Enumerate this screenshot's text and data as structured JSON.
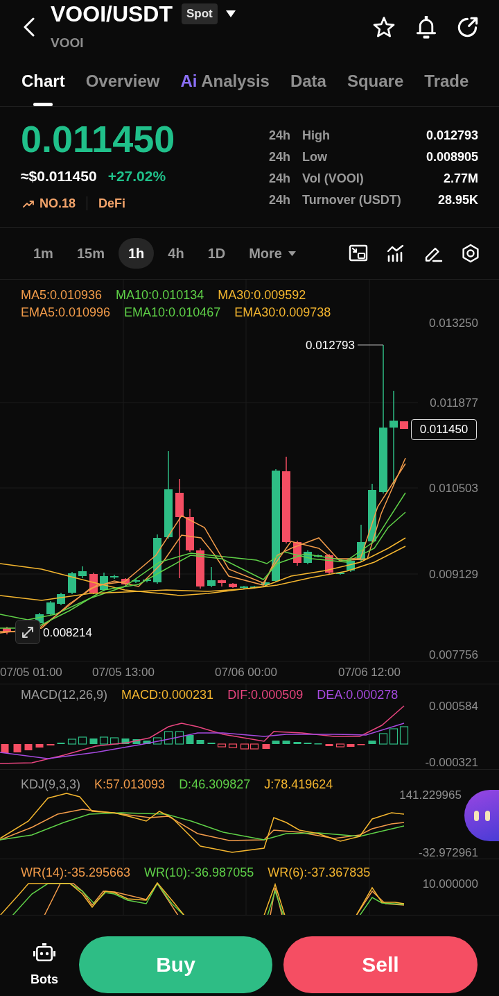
{
  "header": {
    "title": "VOOI/USDT",
    "market_type": "Spot",
    "subtitle": "VOOI"
  },
  "tabs": [
    {
      "label": "Chart",
      "selected": true
    },
    {
      "label": "Overview",
      "selected": false
    },
    {
      "label": "Analysis",
      "prefix": "Ai",
      "selected": false
    },
    {
      "label": "Data",
      "selected": false
    },
    {
      "label": "Square",
      "selected": false
    },
    {
      "label": "Trade",
      "selected": false
    }
  ],
  "ticker": {
    "price": "0.011450",
    "usd_price": "≈$0.011450",
    "change": "+27.02%",
    "rank": "NO.18",
    "sector": "DeFi",
    "stats": [
      {
        "period": "24h",
        "label": "High",
        "value": "0.012793"
      },
      {
        "period": "24h",
        "label": "Low",
        "value": "0.008905"
      },
      {
        "period": "24h",
        "label": "Vol (VOOI)",
        "value": "2.77M"
      },
      {
        "period": "24h",
        "label": "Turnover (USDT)",
        "value": "28.95K"
      }
    ]
  },
  "intervals": [
    {
      "label": "1m",
      "kind": "interval",
      "selected": false
    },
    {
      "label": "15m",
      "kind": "interval",
      "selected": false
    },
    {
      "label": "1h",
      "kind": "interval",
      "selected": true
    },
    {
      "label": "4h",
      "kind": "interval",
      "selected": false
    },
    {
      "label": "1D",
      "kind": "interval",
      "selected": false
    },
    {
      "label": "More",
      "kind": "menu",
      "selected": false
    }
  ],
  "price_chart": {
    "legend_rows": [
      [
        {
          "text": "MA5:0.010936",
          "color": "#f39c4a"
        },
        {
          "text": "MA10:0.010134",
          "color": "#5fd148"
        },
        {
          "text": "MA30:0.009592",
          "color": "#f4b62f"
        }
      ],
      [
        {
          "text": "EMA5:0.010996",
          "color": "#f39c4a"
        },
        {
          "text": "EMA10:0.010467",
          "color": "#5fd148"
        },
        {
          "text": "EMA30:0.009738",
          "color": "#f4b62f"
        }
      ]
    ],
    "y_axis": [
      "0.013250",
      "0.011877",
      "0.010503",
      "0.009129",
      "0.007756"
    ],
    "x_axis": [
      "07/05 01:00",
      "07/05 13:00",
      "07/06 00:00",
      "07/06 12:00"
    ],
    "high_label": "0.012793",
    "low_label": "0.008214",
    "last_price": "0.011450"
  },
  "macd": {
    "title": "MACD(12,26,9)",
    "legend": [
      {
        "text": "MACD:0.000231",
        "color": "#f4b62f"
      },
      {
        "text": "DIF:0.000509",
        "color": "#e8457f"
      },
      {
        "text": "DEA:0.000278",
        "color": "#a64ae0"
      }
    ],
    "y_axis": [
      "0.000584",
      "-0.000321"
    ]
  },
  "kdj": {
    "title": "KDJ(9,3,3)",
    "legend": [
      {
        "text": "K:57.013093",
        "color": "#f39c4a"
      },
      {
        "text": "D:46.309827",
        "color": "#5fd148"
      },
      {
        "text": "J:78.419624",
        "color": "#f4b62f"
      }
    ],
    "y_axis": [
      "141.229965",
      "-32.972961"
    ]
  },
  "wr": {
    "legend": [
      {
        "text": "WR(14):-35.295663",
        "color": "#f39c4a"
      },
      {
        "text": "WR(10):-36.987055",
        "color": "#5fd148"
      },
      {
        "text": "WR(6):-37.367835",
        "color": "#f4b62f"
      }
    ],
    "y_axis": [
      "10.000000"
    ]
  },
  "bottom_bar": {
    "bots_label": "Bots",
    "buy_label": "Buy",
    "sell_label": "Sell"
  }
}
